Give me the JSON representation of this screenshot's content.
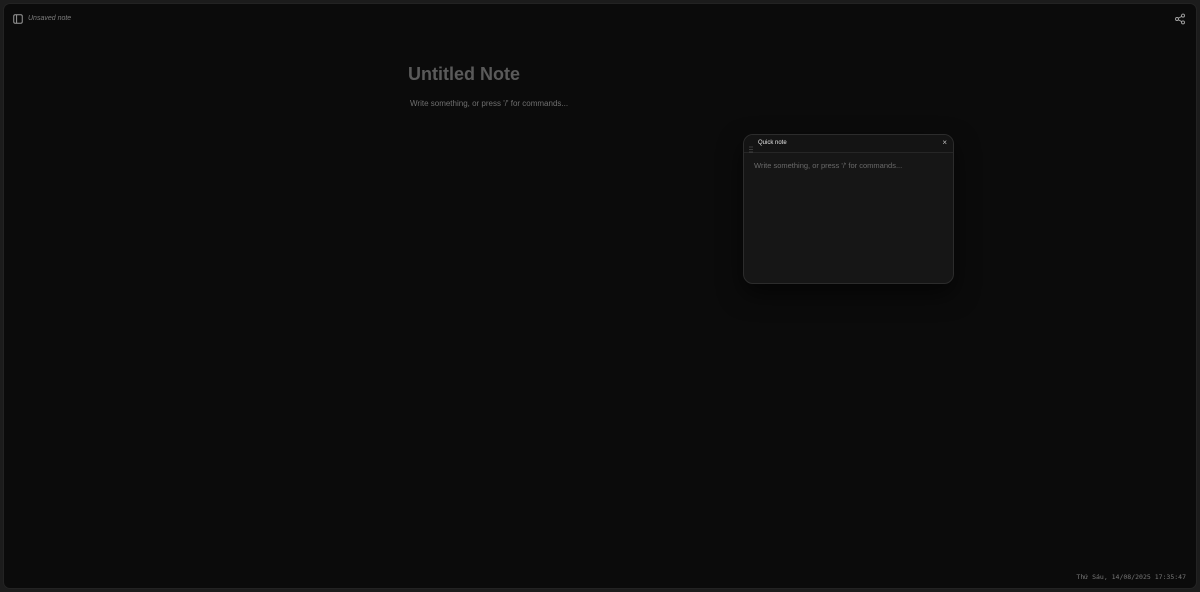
{
  "header": {
    "sidebar_toggle_icon": "sidebar-panel-icon",
    "note_status": "Unsaved note",
    "share_icon": "share-icon"
  },
  "editor": {
    "title_placeholder": "Untitled Note",
    "body_placeholder": "Write something, or press '/' for commands..."
  },
  "quick_note": {
    "title": "Quick note",
    "close_label": "×",
    "drag_icon": "drag-handle-icon",
    "body_placeholder": "Write something, or press '/' for commands..."
  },
  "footer": {
    "datetime": "Thứ Sáu, 14/08/2025 17:35:47"
  },
  "colors": {
    "background": "#0b0b0b",
    "panel": "#161616",
    "title_placeholder": "#5a5a5a"
  }
}
